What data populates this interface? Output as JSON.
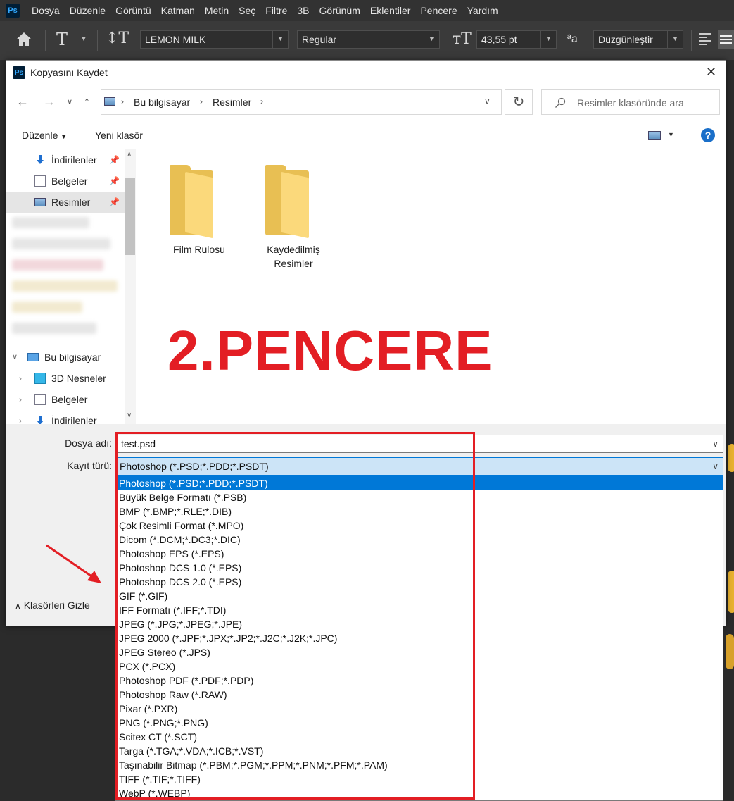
{
  "ps_menu": {
    "logo": "Ps",
    "items": [
      "Dosya",
      "Düzenle",
      "Görüntü",
      "Katman",
      "Metin",
      "Seç",
      "Filtre",
      "3B",
      "Görünüm",
      "Eklentiler",
      "Pencere",
      "Yardım"
    ]
  },
  "ps_options": {
    "font_family": "LEMON MILK",
    "font_style": "Regular",
    "font_size": "43,55 pt",
    "aa_icon_text": "ªa",
    "antialias": "Düzgünleştir"
  },
  "dialog": {
    "title": "Kopyasını Kaydet",
    "logo": "Ps",
    "close": "✕",
    "breadcrumb": [
      "Bu bilgisayar",
      "Resimler"
    ],
    "search_placeholder": "Resimler klasöründe ara",
    "toolbar": {
      "organize": "Düzenle",
      "new_folder": "Yeni klasör",
      "help": "?"
    },
    "quick_access": [
      {
        "label": "İndirilenler"
      },
      {
        "label": "Belgeler"
      },
      {
        "label": "Resimler"
      }
    ],
    "this_pc": {
      "label": "Bu bilgisayar",
      "children": [
        "3D Nesneler",
        "Belgeler",
        "İndirilenler"
      ]
    },
    "folders": [
      {
        "label": "Film Rulosu"
      },
      {
        "label": "Kaydedilmiş Resimler"
      }
    ],
    "annotation": "2.PENCERE",
    "file_name_label": "Dosya adı:",
    "file_name_value": "test.psd",
    "file_type_label": "Kayıt türü:",
    "file_type_value": "Photoshop (*.PSD;*.PDD;*.PSDT)",
    "hide_folders": "Klasörleri Gizle",
    "file_types": [
      "Photoshop (*.PSD;*.PDD;*.PSDT)",
      "Büyük Belge Formatı (*.PSB)",
      "BMP (*.BMP;*.RLE;*.DIB)",
      "Çok Resimli Format (*.MPO)",
      "Dicom (*.DCM;*.DC3;*.DIC)",
      "Photoshop EPS (*.EPS)",
      "Photoshop DCS 1.0 (*.EPS)",
      "Photoshop DCS 2.0 (*.EPS)",
      "GIF (*.GIF)",
      "IFF Formatı (*.IFF;*.TDI)",
      "JPEG (*.JPG;*.JPEG;*.JPE)",
      "JPEG 2000 (*.JPF;*.JPX;*.JP2;*.J2C;*.J2K;*.JPC)",
      "JPEG Stereo (*.JPS)",
      "PCX (*.PCX)",
      "Photoshop PDF (*.PDF;*.PDP)",
      "Photoshop Raw (*.RAW)",
      "Pixar (*.PXR)",
      "PNG (*.PNG;*.PNG)",
      "Scitex CT (*.SCT)",
      "Targa (*.TGA;*.VDA;*.ICB;*.VST)",
      "Taşınabilir Bitmap (*.PBM;*.PGM;*.PPM;*.PNM;*.PFM;*.PAM)",
      "TIFF (*.TIF;*.TIFF)",
      "WebP (*.WEBP)"
    ],
    "selected_index": 0
  },
  "colors": {
    "accent": "#0078d7",
    "annotation_red": "#e31e24"
  }
}
